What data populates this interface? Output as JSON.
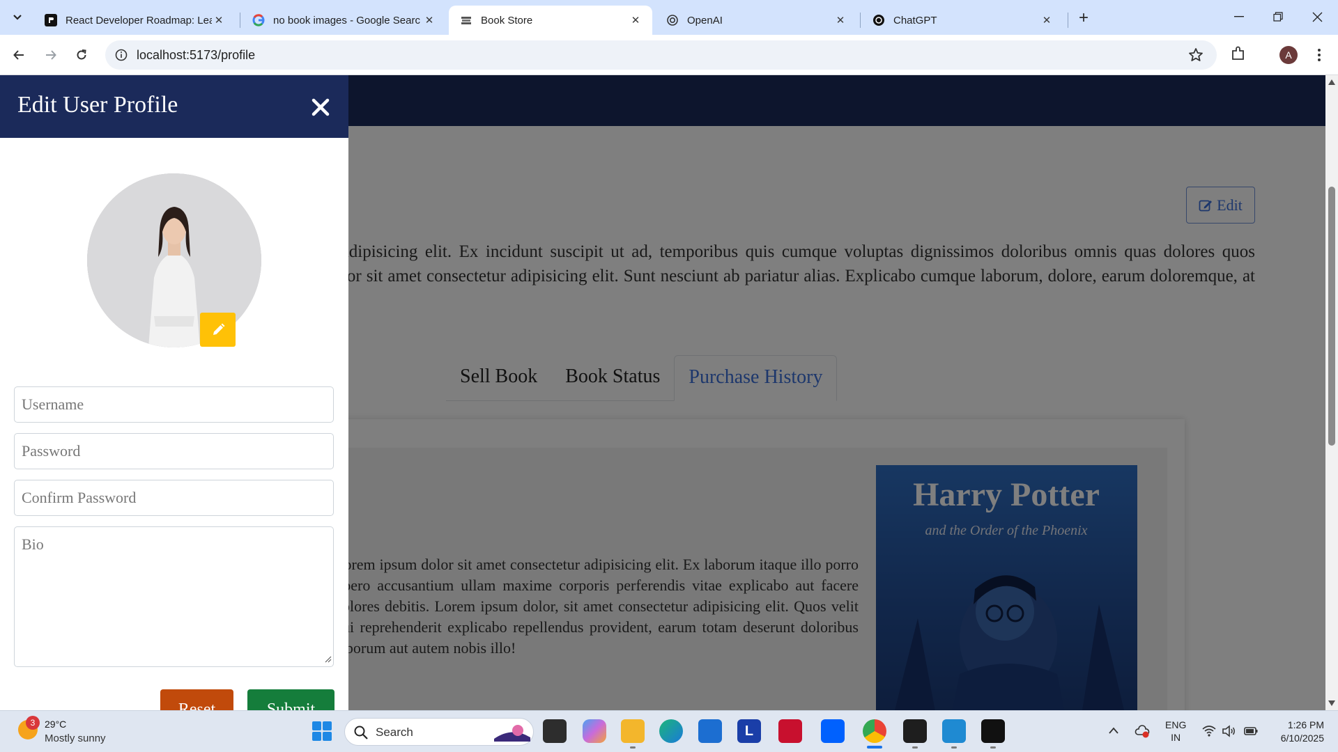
{
  "browser": {
    "tabs": [
      {
        "title": "React Developer Roadmap: Lea",
        "icon": "roadmap-favicon-icon",
        "active": false
      },
      {
        "title": "no book images - Google Searc",
        "icon": "google-icon",
        "active": false
      },
      {
        "title": "Book Store",
        "icon": "bookstore-favicon-icon",
        "active": true
      },
      {
        "title": "OpenAI",
        "icon": "openai-icon",
        "active": false
      },
      {
        "title": "ChatGPT",
        "icon": "chatgpt-icon",
        "active": false
      }
    ],
    "url": "localhost:5173/profile",
    "profile_initial": "A"
  },
  "page": {
    "edit_label": "Edit",
    "about_text": "Lorem ipsum dolor sit amet consectetur adipisicing elit. Ex incidunt suscipit ut ad, temporibus quis cumque voluptas dignissimos doloribus omnis quas dolores quos voluptatum ratione fugit. Lorem ipsum, dolor sit amet consectetur adipisicing elit. Sunt nesciunt ab pariatur alias. Explicabo cumque laborum, dolore, earum doloremque, at enim dolores aliquam minus deserunt",
    "tabs": [
      "Sell Book",
      "Book Status",
      "Purchase History"
    ],
    "active_tab": "Purchase History",
    "card_text": "Lorem ipsum dolor sit amet consectetur adipisicing elit. Ex laborum itaque illo porro libero accusantium ullam maxime corporis perferendis vitae explicabo aut facere dolores debitis. Lorem ipsum dolor, sit amet consectetur adipisicing elit. Quos velit qui reprehenderit explicabo repellendus provident, earum totam deserunt doloribus laborum aut autem nobis illo!",
    "book_cover": {
      "title": "Harry Potter",
      "subtitle": "and the Order of the Phoenix"
    }
  },
  "offcanvas": {
    "title": "Edit User Profile",
    "fields": {
      "username_placeholder": "Username",
      "password_placeholder": "Password",
      "confirm_placeholder": "Confirm Password",
      "bio_placeholder": "Bio"
    },
    "reset_label": "Reset",
    "submit_label": "Submit"
  },
  "taskbar": {
    "weather_temp": "29°C",
    "weather_desc": "Mostly sunny",
    "weather_badge": "3",
    "search_label": "Search",
    "language": "ENG",
    "region": "IN",
    "time": "1:26 PM",
    "date": "6/10/2025"
  },
  "colors": {
    "header_navy": "#1b2a5a",
    "primary_blue": "#3b6fd9",
    "pencil_yellow": "#ffc107",
    "reset_orange": "#c14a0b",
    "submit_green": "#157d3b"
  }
}
